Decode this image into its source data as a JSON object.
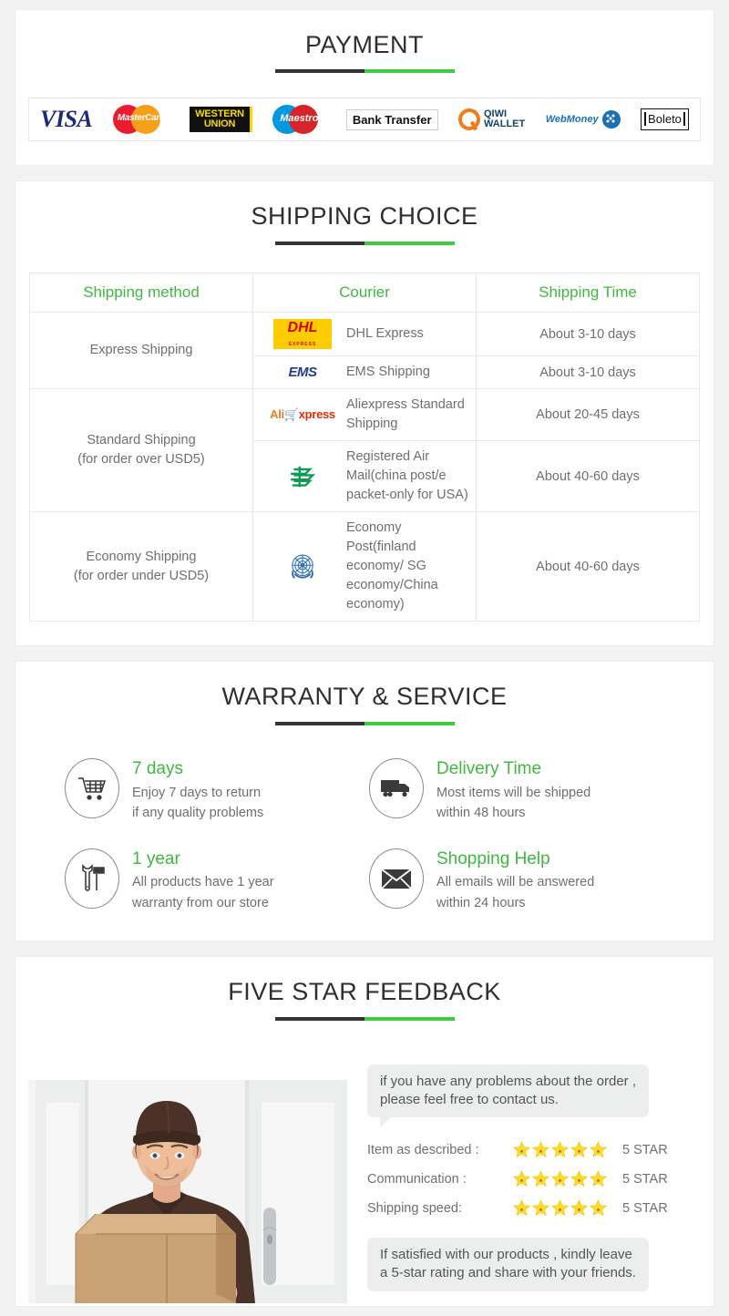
{
  "theme": {
    "accent_green": "#3fb83f",
    "rule_dark": "#333333",
    "rule_green": "#3ecb3e",
    "body_text": "#6f6f6f",
    "page_bg": "#f2f2f2"
  },
  "payment": {
    "title": "PAYMENT",
    "methods": [
      {
        "name": "visa-logo",
        "label": "VISA"
      },
      {
        "name": "mastercard-logo",
        "label": "MasterCard"
      },
      {
        "name": "western-union-logo",
        "line1": "WESTERN",
        "line2": "UNION"
      },
      {
        "name": "maestro-logo",
        "label": "Maestro"
      },
      {
        "name": "bank-transfer-logo",
        "label": "Bank Transfer"
      },
      {
        "name": "qiwi-wallet-logo",
        "line1": "QIWI",
        "line2": "WALLET"
      },
      {
        "name": "webmoney-logo",
        "label": "WebMoney"
      },
      {
        "name": "boleto-logo",
        "label": "Boleto"
      }
    ]
  },
  "shipping": {
    "title": "SHIPPING CHOICE",
    "columns": [
      "Shipping method",
      "Courier",
      "Shipping Time"
    ],
    "rows": [
      {
        "method": "Express Shipping",
        "method_line2": "",
        "method_rowspan": 2,
        "courier_logo": "dhl-logo",
        "courier_logo_text": "DHL",
        "courier_logo_sub": "EXPRESS",
        "courier": "DHL Express",
        "time": "About 3-10 days"
      },
      {
        "courier_logo": "ems-logo",
        "courier_logo_text": "EMS",
        "courier": "EMS Shipping",
        "time": "About 3-10 days"
      },
      {
        "method": "Standard Shipping",
        "method_line2": "(for order over USD5)",
        "method_rowspan": 2,
        "courier_logo": "aliexpress-logo",
        "courier_logo_text": "AliExpress",
        "courier": "Aliexpress Standard Shipping",
        "time": "About 20-45 days"
      },
      {
        "courier_logo": "china-post-logo",
        "courier": "Registered Air Mail(china post/e packet-only for USA)",
        "time": "About 40-60 days"
      },
      {
        "method": "Economy Shipping",
        "method_line2": "(for order under USD5)",
        "method_rowspan": 1,
        "courier_logo": "un-post-logo",
        "courier": "Economy Post(finland economy/ SG economy/China economy)",
        "time": "About 40-60 days"
      }
    ]
  },
  "warranty": {
    "title": "WARRANTY & SERVICE",
    "items": [
      {
        "icon": "shopping-cart-icon",
        "title": "7 days",
        "desc_line1": "Enjoy 7 days to return",
        "desc_line2": "if any quality problems"
      },
      {
        "icon": "delivery-truck-icon",
        "title": "Delivery Time",
        "desc_line1": "Most items will be shipped",
        "desc_line2": "within 48 hours"
      },
      {
        "icon": "tools-icon",
        "title": "1 year",
        "desc_line1": "All products have 1 year",
        "desc_line2": "warranty from our store"
      },
      {
        "icon": "envelope-icon",
        "title": "Shopping Help",
        "desc_line1": "All emails will be answered",
        "desc_line2": "within 24 hours"
      }
    ]
  },
  "feedback": {
    "title": "FIVE STAR FEEDBACK",
    "photo_alt": "delivery-man-holding-box-photo",
    "bubble_top_line1": "if you have any problems about the order ,",
    "bubble_top_line2": "please feel free to contact us.",
    "ratings": [
      {
        "label": "Item as described :",
        "stars": 5,
        "value": "5 STAR"
      },
      {
        "label": "Communication :",
        "stars": 5,
        "value": "5 STAR"
      },
      {
        "label": "Shipping speed:",
        "stars": 5,
        "value": "5 STAR"
      }
    ],
    "bubble_bottom_line1": "If satisfied with our products ,  kindly leave",
    "bubble_bottom_line2": "a 5-star rating and share with your friends."
  }
}
